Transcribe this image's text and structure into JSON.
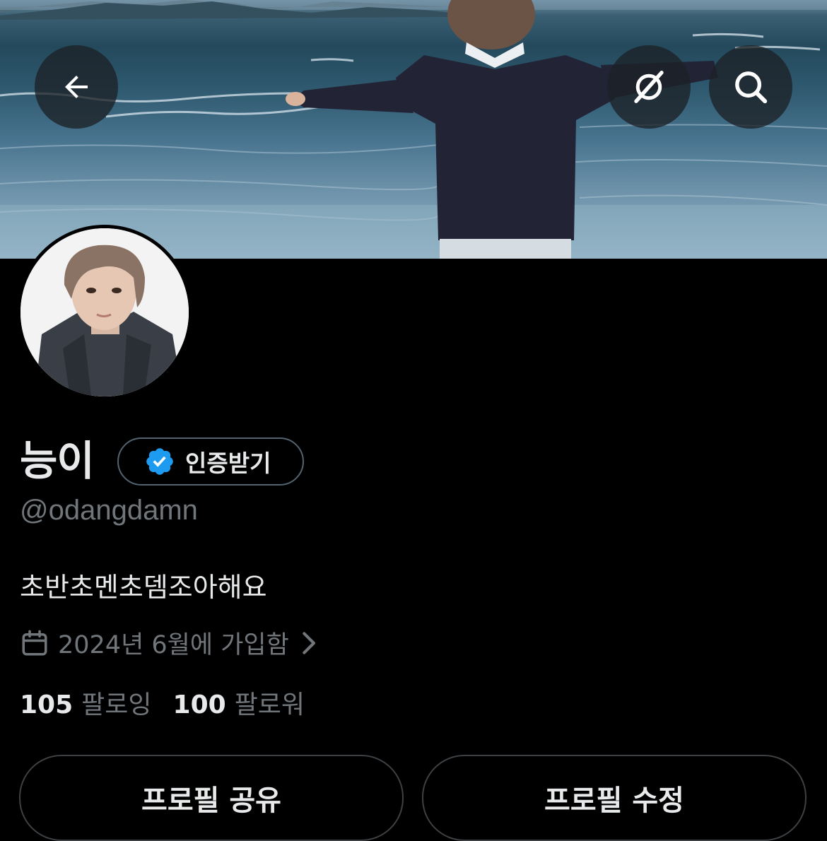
{
  "header": {
    "back_icon": "arrow-left-icon",
    "grok_icon": "grok-icon",
    "search_icon": "search-icon"
  },
  "profile": {
    "display_name": "능이",
    "verify_label": "인증받기",
    "verify_icon": "verified-badge-icon",
    "handle": "@odangdamn",
    "bio": "초반초멘초뎀조아해요",
    "joined": "2024년 6월에 가입함",
    "following_count": "105",
    "following_label": "팔로잉",
    "followers_count": "100",
    "followers_label": "팔로워"
  },
  "actions": {
    "share_label": "프로필 공유",
    "edit_label": "프로필 수정"
  },
  "colors": {
    "background": "#000000",
    "primary_text": "#e7e9ea",
    "secondary_text": "#71767b",
    "verified_blue": "#1d9bf0",
    "border": "#3e4144"
  }
}
